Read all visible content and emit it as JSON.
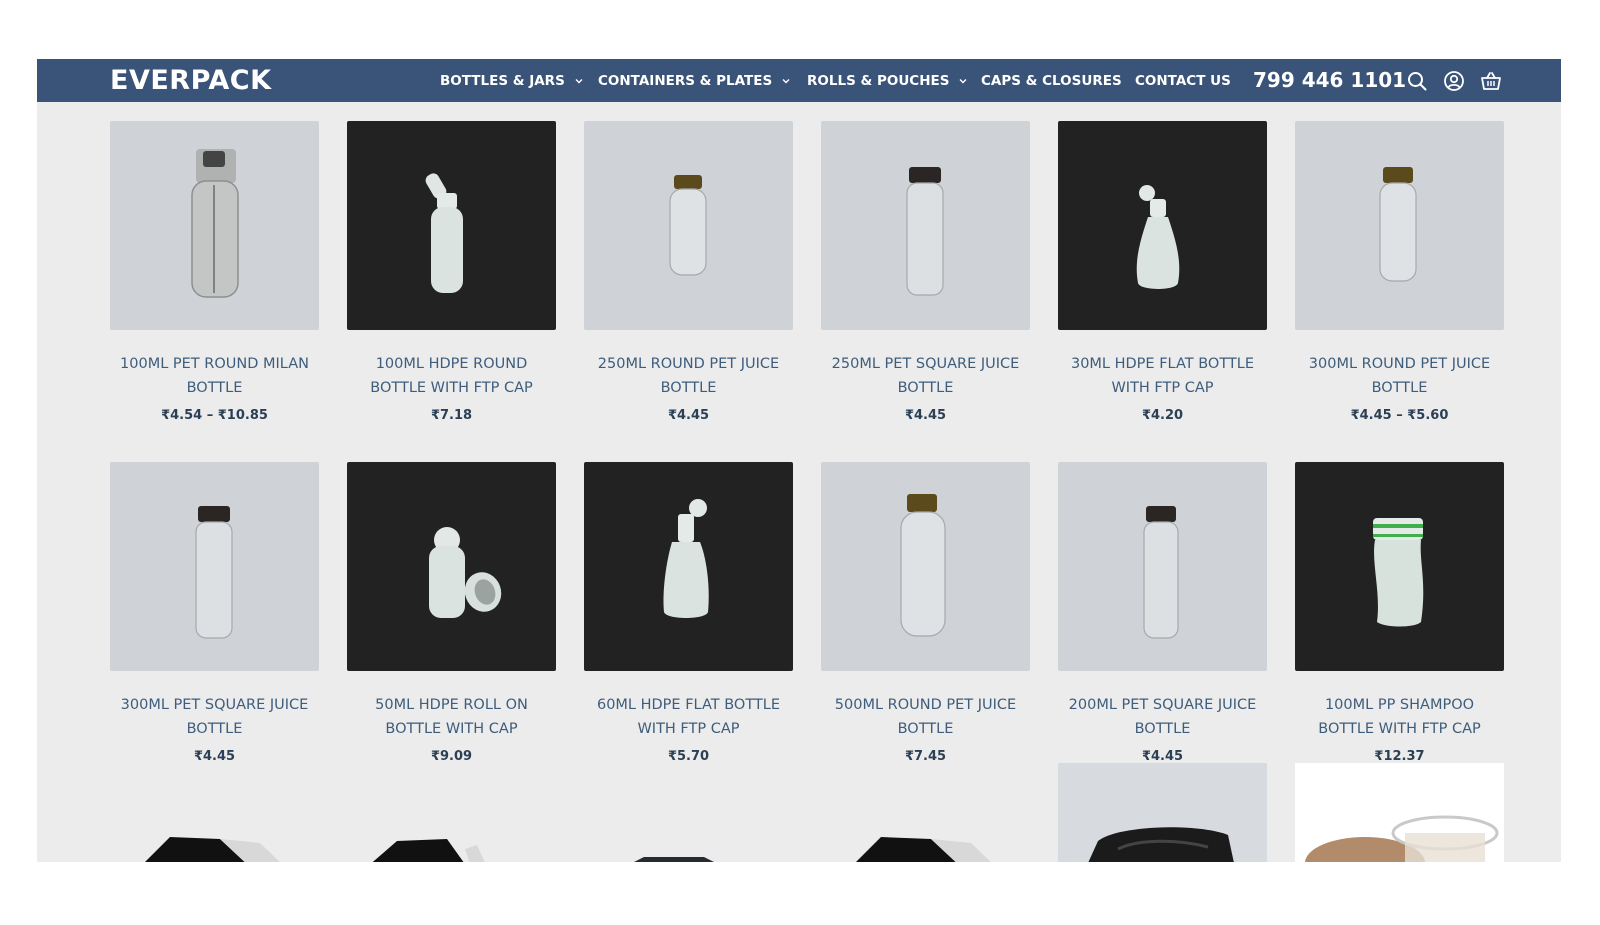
{
  "header": {
    "logo": "EVERPACK",
    "nav": [
      {
        "label": "BOTTLES & JARS",
        "dropdown": true
      },
      {
        "label": "CONTAINERS & PLATES",
        "dropdown": true
      },
      {
        "label": "ROLLS & POUCHES",
        "dropdown": true
      },
      {
        "label": "CAPS & CLOSURES",
        "dropdown": false
      },
      {
        "label": "CONTACT US",
        "dropdown": false
      }
    ],
    "phone": "799 446 1101",
    "icons": [
      "search-icon",
      "account-icon",
      "cart-icon"
    ]
  },
  "products": [
    {
      "title": "100ML PET ROUND MILAN BOTTLE",
      "price": "₹4.54 – ₹10.85",
      "bg": "light"
    },
    {
      "title": "100ML HDPE ROUND BOTTLE WITH FTP CAP",
      "price": "₹7.18",
      "bg": "dark"
    },
    {
      "title": "250ML ROUND PET JUICE BOTTLE",
      "price": "₹4.45",
      "bg": "light"
    },
    {
      "title": "250ML PET SQUARE JUICE BOTTLE",
      "price": "₹4.45",
      "bg": "light"
    },
    {
      "title": "30ML HDPE FLAT BOTTLE WITH FTP CAP",
      "price": "₹4.20",
      "bg": "dark"
    },
    {
      "title": "300ML ROUND PET JUICE BOTTLE",
      "price": "₹4.45 – ₹5.60",
      "bg": "light"
    },
    {
      "title": "300ML PET SQUARE JUICE BOTTLE",
      "price": "₹4.45",
      "bg": "light"
    },
    {
      "title": "50ML HDPE ROLL ON BOTTLE WITH CAP",
      "price": "₹9.09",
      "bg": "dark"
    },
    {
      "title": "60ML HDPE FLAT BOTTLE WITH FTP CAP",
      "price": "₹5.70",
      "bg": "dark"
    },
    {
      "title": "500ML ROUND PET JUICE BOTTLE",
      "price": "₹7.45",
      "bg": "light"
    },
    {
      "title": "200ML PET SQUARE JUICE BOTTLE",
      "price": "₹4.45",
      "bg": "light"
    },
    {
      "title": "100ML PP SHAMPOO BOTTLE WITH FTP CAP",
      "price": "₹12.37",
      "bg": "dark"
    }
  ],
  "colors": {
    "header_bg": "#3a5479",
    "page_bg": "#ececec",
    "title_color": "#3e5d7c",
    "price_color": "#2b3f55"
  }
}
